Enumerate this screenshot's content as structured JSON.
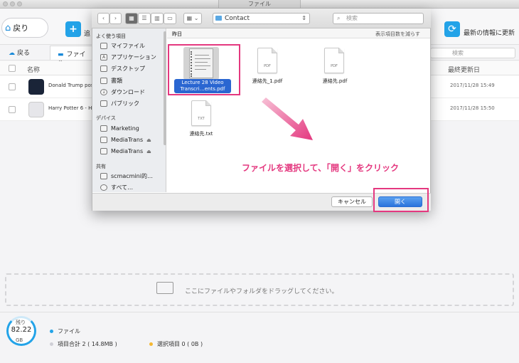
{
  "window": {
    "title": "ファイル"
  },
  "app": {
    "back_label": "戻り",
    "add_label": "追",
    "refresh_label": "最新の情報に更新",
    "sub_back_label": "戻る",
    "sub_tab_label": "ファイル",
    "search_placeholder": "検索",
    "columns": {
      "name": "名称",
      "date": "最終更新日"
    },
    "rows": [
      {
        "name": "Donald Trump post",
        "date": "2017/11/28  15:49"
      },
      {
        "name": "Harry Potter 6 - Ha",
        "date": "2017/11/28  15:50"
      }
    ],
    "drop_text": "ここにファイルやフォルダをドラッグしてください。"
  },
  "footer": {
    "storage_label": "残り",
    "storage_value": "82.22",
    "storage_unit": "GB",
    "legend_file": "ファイル",
    "legend_total": "項目合計 2 ( 14.8MB )",
    "legend_selected": "選択項目 0 ( 0B )"
  },
  "dialog": {
    "path": "Contact",
    "search_placeholder": "検索",
    "sidebar": {
      "favorites_heading": "よく使う項目",
      "favorites": [
        "マイファイル",
        "アプリケーション",
        "デスクトップ",
        "書類",
        "ダウンロード",
        "パブリック"
      ],
      "devices_heading": "デバイス",
      "devices": [
        "Marketing",
        "MediaTrans",
        "MediaTrans"
      ],
      "shared_heading": "共有",
      "shared": [
        "scmacmini的…",
        "すべて…"
      ]
    },
    "group_label": "昨日",
    "count_label": "表示項目数を減らす",
    "files": [
      {
        "name_line1": "Lecture 28 Video",
        "name_line2": "Transcri…ents.pdf",
        "tag": "",
        "selected": true
      },
      {
        "name": "連絡先_1.pdf",
        "tag": "PDF"
      },
      {
        "name": "連絡先.pdf",
        "tag": "PDF"
      },
      {
        "name": "連絡先.txt",
        "tag": "TXT"
      }
    ],
    "cancel_label": "キャンセル",
    "open_label": "開く"
  },
  "annotation": {
    "callout": "ファイルを選択して、「開く」をクリック"
  },
  "colors": {
    "accent": "#23a3e8",
    "highlight": "#e4387f",
    "selection": "#2a66d1"
  }
}
